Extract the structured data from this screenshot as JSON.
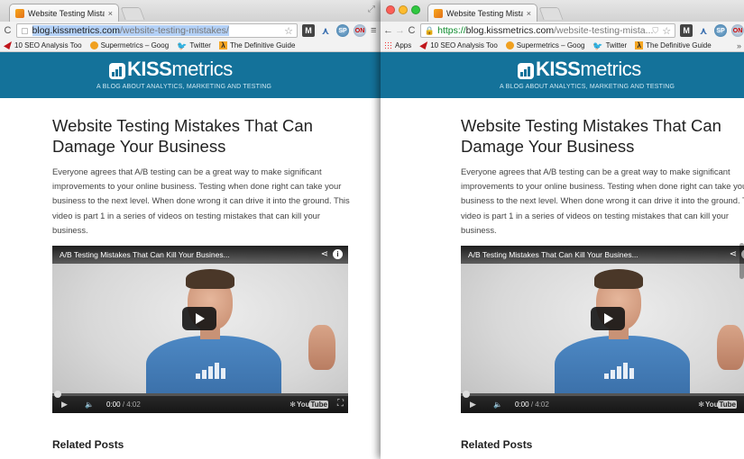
{
  "left_window": {
    "tab_title": "Website Testing Mistakes",
    "tab_close": "×",
    "window_control": "⤢",
    "url_host": "blog.kissmetrics.com",
    "url_path": "/website-testing-mistakes/",
    "bookmarks": [
      {
        "label": "10 SEO Analysis Too",
        "icon": "red-flag-icon"
      },
      {
        "label": "Supermetrics – Goog",
        "icon": "supermetrics-icon"
      },
      {
        "label": "Twitter",
        "icon": "twitter-icon"
      },
      {
        "label": "The Definitive Guide",
        "icon": "lambda-icon"
      }
    ]
  },
  "right_window": {
    "tab_title": "Website Testing Mistakes",
    "tab_close": "×",
    "url_scheme": "https://",
    "url_host": "blog.kissmetrics.com",
    "url_path": "/website-testing-mista...",
    "bookmarks": [
      {
        "label": "Apps",
        "icon": "apps-icon"
      },
      {
        "label": "10 SEO Analysis Too",
        "icon": "red-flag-icon"
      },
      {
        "label": "Supermetrics – Goog",
        "icon": "supermetrics-icon"
      },
      {
        "label": "Twitter",
        "icon": "twitter-icon"
      },
      {
        "label": "The Definitive Guide",
        "icon": "lambda-icon"
      }
    ],
    "bookmark_more": "»"
  },
  "toolbar": {
    "back": "←",
    "forward": "→",
    "reload": "C",
    "star": "☆",
    "menu": "≡",
    "extensions": {
      "m": "M",
      "k": "⋏",
      "s": "SP",
      "o": "ON"
    }
  },
  "site": {
    "logo_bold": "KISS",
    "logo_light": "metrics",
    "tagline": "A BLOG ABOUT ANALYTICS, MARKETING AND TESTING",
    "colors": {
      "header": "#14729a",
      "text": "#444444"
    }
  },
  "article": {
    "title": "Website Testing Mistakes That Can Damage Your Business",
    "intro": "Everyone agrees that A/B testing can be a great way to make significant improvements to your online business. Testing when done right can take your business to the next level. When done wrong it can drive it into the ground. This video is part 1 in a series of videos on testing mistakes that can kill your business.",
    "related_heading": "Related Posts"
  },
  "video": {
    "title": "A/B Testing Mistakes That Can Kill Your Busines...",
    "current_time": "0:00",
    "duration": "/ 4:02",
    "share_icon": "share-icon",
    "info_label": "i",
    "youtube_you": "You",
    "youtube_tube": "Tube",
    "progress": 0
  }
}
